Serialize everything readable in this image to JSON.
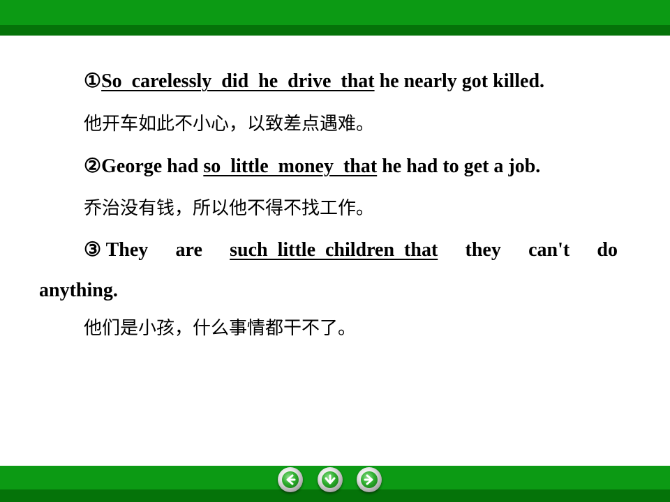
{
  "lines": {
    "l1": {
      "marker": "①",
      "u1": "So  carelessly  did  he  drive  that",
      "rest": " he nearly got killed."
    },
    "l2": "他开车如此不小心，以致差点遇难。",
    "l3": {
      "marker": "②",
      "pre": "George had ",
      "u1": "so  little  money  that",
      "rest": " he had to get a job."
    },
    "l4": "乔治没有钱，所以他不得不找工作。",
    "l5": {
      "marker": "③ They",
      "w2": "are",
      "u1": "such  little  children  that",
      "w4": "they",
      "w5": "can't",
      "w6": "do"
    },
    "l6": "anything.",
    "l7": "他们是小孩，什么事情都干不了。"
  },
  "nav": {
    "prev": "arrow-left-icon",
    "down": "arrow-down-icon",
    "next": "arrow-right-icon"
  },
  "colors": {
    "bar_light": "#0c9a14",
    "bar_dark": "#057309"
  }
}
